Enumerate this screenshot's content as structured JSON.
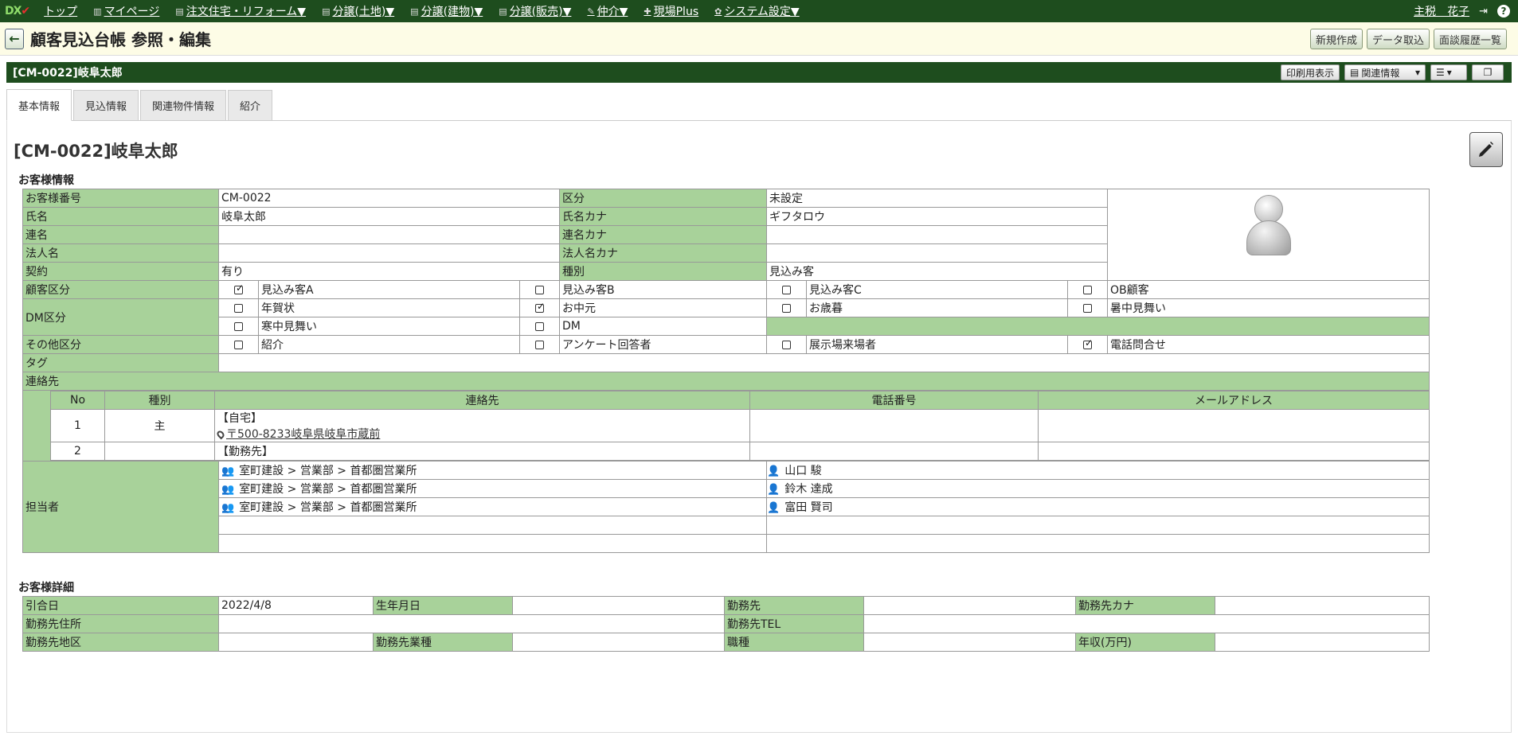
{
  "nav": {
    "logo_a": "DX",
    "logo_b": "✔",
    "items": [
      {
        "icon": "",
        "label": "トップ"
      },
      {
        "icon": "▥",
        "label": "マイページ"
      },
      {
        "icon": "▤",
        "label": "注文住宅・リフォーム▼"
      },
      {
        "icon": "▤",
        "label": "分譲(土地)▼"
      },
      {
        "icon": "▤",
        "label": "分譲(建物)▼"
      },
      {
        "icon": "▤",
        "label": "分譲(販売)▼"
      },
      {
        "icon": "✎",
        "label": "仲介▼"
      },
      {
        "icon": "✚",
        "label": "現場Plus"
      },
      {
        "icon": "✿",
        "label": "システム設定▼"
      }
    ],
    "user": "主税　花子",
    "help": "?",
    "logout": "⇥"
  },
  "title": {
    "text": "顧客見込台帳 参照・編集",
    "buttons": [
      "新規作成",
      "データ取込",
      "面談履歴一覧"
    ]
  },
  "record": {
    "bar_title": "[CM-0022]岐阜太郎",
    "print": "印刷用表示",
    "related": "関連情報",
    "heading": "[CM-0022]岐阜太郎"
  },
  "tabs": [
    "基本情報",
    "見込情報",
    "関連物件情報",
    "紹介"
  ],
  "customer": {
    "section": "お客様情報",
    "rows": [
      {
        "l1": "お客様番号",
        "v1": "CM-0022",
        "l2": "区分",
        "v2": "未設定"
      },
      {
        "l1": "氏名",
        "v1": "岐阜太郎",
        "l2": "氏名カナ",
        "v2": "ギフタロウ"
      },
      {
        "l1": "連名",
        "v1": "",
        "l2": "連名カナ",
        "v2": ""
      },
      {
        "l1": "法人名",
        "v1": "",
        "l2": "法人名カナ",
        "v2": ""
      },
      {
        "l1": "契約",
        "v1": "有り",
        "l2": "種別",
        "v2": "見込み客"
      }
    ],
    "kokyaku": {
      "label": "顧客区分",
      "opts": [
        "見込み客A",
        "見込み客B",
        "見込み客C",
        "OB顧客"
      ],
      "checked": [
        true,
        false,
        false,
        false
      ]
    },
    "dm": {
      "label": "DM区分",
      "opts1": [
        "年賀状",
        "お中元",
        "お歳暮",
        "暑中見舞い"
      ],
      "checked1": [
        false,
        true,
        false,
        false
      ],
      "opts2": [
        "寒中見舞い",
        "DM"
      ],
      "checked2": [
        false,
        false
      ]
    },
    "other": {
      "label": "その他区分",
      "opts": [
        "紹介",
        "アンケート回答者",
        "展示場来場者",
        "電話問合せ"
      ],
      "checked": [
        false,
        false,
        false,
        true
      ]
    },
    "tag": {
      "label": "タグ",
      "value": ""
    },
    "contacts": {
      "label": "連絡先",
      "headers": [
        "No",
        "種別",
        "連絡先",
        "電話番号",
        "メールアドレス"
      ],
      "rows": [
        {
          "no": "1",
          "type": "主",
          "name": "【自宅】",
          "addr": "〒500-8233岐阜県岐阜市蔵前",
          "tel": "",
          "mail": ""
        },
        {
          "no": "2",
          "type": "",
          "name": "【勤務先】",
          "addr": "",
          "tel": "",
          "mail": ""
        }
      ]
    },
    "staff": {
      "label": "担当者",
      "rows": [
        {
          "org": "室町建設 > 営業部 > 首都圏営業所",
          "person": "山口 駿"
        },
        {
          "org": "室町建設 > 営業部 > 首都圏営業所",
          "person": "鈴木 達成"
        },
        {
          "org": "室町建設 > 営業部 > 首都圏営業所",
          "person": "富田 賢司"
        }
      ]
    }
  },
  "detail": {
    "section": "お客様詳細",
    "r1": [
      "引合日",
      "2022/4/8",
      "生年月日",
      "",
      "勤務先",
      "",
      "勤務先カナ",
      ""
    ],
    "r2": [
      "勤務先住所",
      "",
      "勤務先TEL",
      ""
    ],
    "r3": [
      "勤務先地区",
      "",
      "勤務先業種",
      "",
      "職種",
      "",
      "年収(万円)",
      ""
    ]
  }
}
